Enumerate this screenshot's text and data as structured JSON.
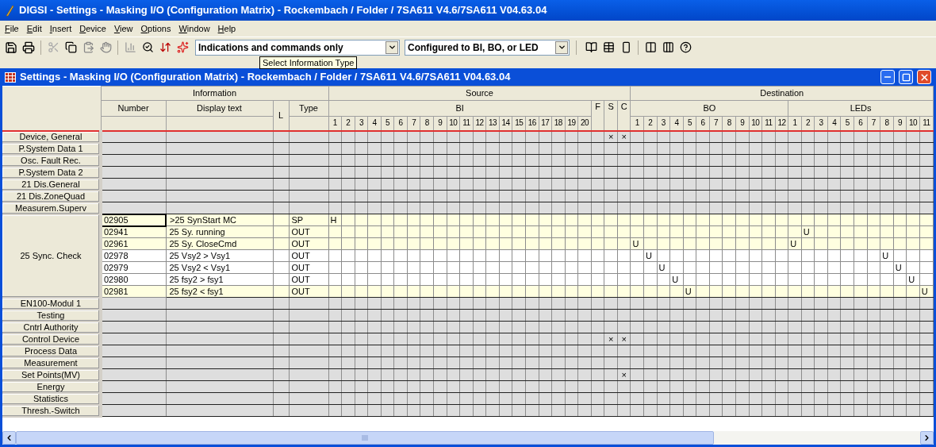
{
  "app_title": "DIGSI - Settings - Masking I/O (Configuration Matrix) - Rockembach / Folder / 7SA611 V4.6/7SA611 V04.63.04",
  "menu": [
    "File",
    "Edit",
    "Insert",
    "Device",
    "View",
    "Options",
    "Window",
    "Help"
  ],
  "toolbar": {
    "info_type": "Indications and commands only",
    "filter": "Configured to BI, BO, or LED",
    "tooltip": "Select Information Type"
  },
  "document_title": "Settings - Masking I/O (Configuration Matrix) - Rockembach / Folder / 7SA611 V4.6/7SA611 V04.63.04",
  "matrix": {
    "headers": {
      "information": "Information",
      "source": "Source",
      "destination": "Destination",
      "number": "Number",
      "display_text": "Display text",
      "l": "L",
      "type": "Type",
      "bi": "BI",
      "bo": "BO",
      "leds": "LEDs"
    },
    "bi_columns": [
      "1",
      "2",
      "3",
      "4",
      "5",
      "6",
      "7",
      "8",
      "9",
      "10",
      "11",
      "12",
      "13",
      "14",
      "15",
      "16",
      "17",
      "18",
      "19",
      "20"
    ],
    "fsc_columns": [
      "F",
      "S",
      "C"
    ],
    "bo_columns": [
      "1",
      "2",
      "3",
      "4",
      "5",
      "6",
      "7",
      "8",
      "9",
      "10",
      "11",
      "12"
    ],
    "led_columns": [
      "1",
      "2",
      "3",
      "4",
      "5",
      "6",
      "7",
      "8",
      "9",
      "10",
      "11"
    ],
    "groups": [
      {
        "name": "Device, General",
        "s_mark": "×",
        "c_mark": "×"
      },
      {
        "name": "P.System Data 1"
      },
      {
        "name": "Osc. Fault Rec."
      },
      {
        "name": "P.System Data 2"
      },
      {
        "name": "21 Dis.General"
      },
      {
        "name": "21 Dis.ZoneQuad"
      },
      {
        "name": "Measurem.Superv"
      },
      {
        "name": "25 Sync. Check",
        "rows": [
          {
            "number": "02905",
            "text": ">25 SynStart MC",
            "type": "SP",
            "shaded": true,
            "selected": true,
            "bi": [
              {
                "kind": "mark",
                "text": "H"
              },
              {
                "kind": "empty"
              },
              {
                "kind": "empty"
              },
              {
                "kind": "empty"
              },
              {
                "kind": "empty"
              },
              {
                "kind": "empty"
              },
              {
                "kind": "empty"
              },
              {
                "kind": "empty"
              },
              {
                "kind": "empty"
              },
              {
                "kind": "empty"
              },
              {
                "kind": "empty"
              },
              {
                "kind": "empty"
              },
              {
                "kind": "empty"
              },
              {
                "kind": "empty"
              },
              {
                "kind": "empty"
              },
              {
                "kind": "empty"
              },
              {
                "kind": "empty"
              },
              {
                "kind": "empty"
              },
              {
                "kind": "empty"
              },
              {
                "kind": "empty"
              }
            ],
            "bo": [
              {
                "kind": "empty"
              },
              {
                "kind": "empty"
              },
              {
                "kind": "empty"
              },
              {
                "kind": "empty"
              },
              {
                "kind": "empty"
              },
              {
                "kind": "empty"
              },
              {
                "kind": "empty"
              },
              {
                "kind": "empty"
              },
              {
                "kind": "empty"
              },
              {
                "kind": "empty"
              },
              {
                "kind": "empty"
              },
              {
                "kind": "empty"
              }
            ],
            "leds": [
              {
                "kind": "empty"
              },
              {
                "kind": "empty"
              },
              {
                "kind": "empty"
              },
              {
                "kind": "empty"
              },
              {
                "kind": "empty"
              },
              {
                "kind": "empty"
              },
              {
                "kind": "empty"
              },
              {
                "kind": "empty"
              },
              {
                "kind": "empty"
              },
              {
                "kind": "empty"
              },
              {
                "kind": "empty"
              }
            ]
          },
          {
            "number": "02941",
            "text": "25 Sy. running",
            "type": "OUT",
            "shaded": true,
            "selected": false,
            "bi": [
              {
                "kind": "empty"
              },
              {
                "kind": "empty"
              },
              {
                "kind": "empty"
              },
              {
                "kind": "empty"
              },
              {
                "kind": "empty"
              },
              {
                "kind": "empty"
              },
              {
                "kind": "empty"
              },
              {
                "kind": "empty"
              },
              {
                "kind": "empty"
              },
              {
                "kind": "empty"
              },
              {
                "kind": "empty"
              },
              {
                "kind": "empty"
              },
              {
                "kind": "empty"
              },
              {
                "kind": "empty"
              },
              {
                "kind": "empty"
              },
              {
                "kind": "empty"
              },
              {
                "kind": "empty"
              },
              {
                "kind": "empty"
              },
              {
                "kind": "empty"
              },
              {
                "kind": "empty"
              }
            ],
            "bo": [
              {
                "kind": "empty"
              },
              {
                "kind": "empty"
              },
              {
                "kind": "empty"
              },
              {
                "kind": "empty"
              },
              {
                "kind": "empty"
              },
              {
                "kind": "empty"
              },
              {
                "kind": "empty"
              },
              {
                "kind": "empty"
              },
              {
                "kind": "empty"
              },
              {
                "kind": "empty"
              },
              {
                "kind": "empty"
              },
              {
                "kind": "empty"
              }
            ],
            "leds": [
              {
                "kind": "empty"
              },
              {
                "kind": "mark",
                "text": "U"
              },
              {
                "kind": "empty"
              },
              {
                "kind": "empty"
              },
              {
                "kind": "empty"
              },
              {
                "kind": "empty"
              },
              {
                "kind": "empty"
              },
              {
                "kind": "empty"
              },
              {
                "kind": "empty"
              },
              {
                "kind": "empty"
              },
              {
                "kind": "empty"
              }
            ]
          },
          {
            "number": "02961",
            "text": "25 Sy. CloseCmd",
            "type": "OUT",
            "shaded": true,
            "selected": false,
            "bi": [
              {
                "kind": "empty"
              },
              {
                "kind": "empty"
              },
              {
                "kind": "empty"
              },
              {
                "kind": "empty"
              },
              {
                "kind": "empty"
              },
              {
                "kind": "empty"
              },
              {
                "kind": "empty"
              },
              {
                "kind": "empty"
              },
              {
                "kind": "empty"
              },
              {
                "kind": "empty"
              },
              {
                "kind": "empty"
              },
              {
                "kind": "empty"
              },
              {
                "kind": "empty"
              },
              {
                "kind": "empty"
              },
              {
                "kind": "empty"
              },
              {
                "kind": "empty"
              },
              {
                "kind": "empty"
              },
              {
                "kind": "empty"
              },
              {
                "kind": "empty"
              },
              {
                "kind": "empty"
              }
            ],
            "bo": [
              {
                "kind": "mark",
                "text": "U"
              },
              {
                "kind": "empty"
              },
              {
                "kind": "empty"
              },
              {
                "kind": "empty"
              },
              {
                "kind": "empty"
              },
              {
                "kind": "empty"
              },
              {
                "kind": "empty"
              },
              {
                "kind": "empty"
              },
              {
                "kind": "empty"
              },
              {
                "kind": "empty"
              },
              {
                "kind": "empty"
              },
              {
                "kind": "empty"
              }
            ],
            "leds": [
              {
                "kind": "mark",
                "text": "U"
              },
              {
                "kind": "empty"
              },
              {
                "kind": "empty"
              },
              {
                "kind": "empty"
              },
              {
                "kind": "empty"
              },
              {
                "kind": "empty"
              },
              {
                "kind": "empty"
              },
              {
                "kind": "empty"
              },
              {
                "kind": "empty"
              },
              {
                "kind": "empty"
              },
              {
                "kind": "empty"
              }
            ]
          },
          {
            "number": "02978",
            "text": "25 Vsy2 > Vsy1",
            "type": "OUT",
            "shaded": false,
            "selected": false,
            "bi": [
              {
                "kind": "empty"
              },
              {
                "kind": "empty"
              },
              {
                "kind": "empty"
              },
              {
                "kind": "empty"
              },
              {
                "kind": "empty"
              },
              {
                "kind": "empty"
              },
              {
                "kind": "empty"
              },
              {
                "kind": "empty"
              },
              {
                "kind": "empty"
              },
              {
                "kind": "empty"
              },
              {
                "kind": "empty"
              },
              {
                "kind": "empty"
              },
              {
                "kind": "empty"
              },
              {
                "kind": "empty"
              },
              {
                "kind": "empty"
              },
              {
                "kind": "empty"
              },
              {
                "kind": "empty"
              },
              {
                "kind": "empty"
              },
              {
                "kind": "empty"
              },
              {
                "kind": "empty"
              }
            ],
            "bo": [
              {
                "kind": "empty"
              },
              {
                "kind": "mark",
                "text": "U"
              },
              {
                "kind": "empty"
              },
              {
                "kind": "empty"
              },
              {
                "kind": "empty"
              },
              {
                "kind": "empty"
              },
              {
                "kind": "empty"
              },
              {
                "kind": "empty"
              },
              {
                "kind": "empty"
              },
              {
                "kind": "empty"
              },
              {
                "kind": "empty"
              },
              {
                "kind": "empty"
              }
            ],
            "leds": [
              {
                "kind": "empty"
              },
              {
                "kind": "empty"
              },
              {
                "kind": "empty"
              },
              {
                "kind": "empty"
              },
              {
                "kind": "empty"
              },
              {
                "kind": "empty"
              },
              {
                "kind": "empty"
              },
              {
                "kind": "mark",
                "text": "U"
              },
              {
                "kind": "empty"
              },
              {
                "kind": "empty"
              },
              {
                "kind": "empty"
              }
            ]
          },
          {
            "number": "02979",
            "text": "25 Vsy2 < Vsy1",
            "type": "OUT",
            "shaded": false,
            "selected": false,
            "bi": [
              {
                "kind": "empty"
              },
              {
                "kind": "empty"
              },
              {
                "kind": "empty"
              },
              {
                "kind": "empty"
              },
              {
                "kind": "empty"
              },
              {
                "kind": "empty"
              },
              {
                "kind": "empty"
              },
              {
                "kind": "empty"
              },
              {
                "kind": "empty"
              },
              {
                "kind": "empty"
              },
              {
                "kind": "empty"
              },
              {
                "kind": "empty"
              },
              {
                "kind": "empty"
              },
              {
                "kind": "empty"
              },
              {
                "kind": "empty"
              },
              {
                "kind": "empty"
              },
              {
                "kind": "empty"
              },
              {
                "kind": "empty"
              },
              {
                "kind": "empty"
              },
              {
                "kind": "empty"
              }
            ],
            "bo": [
              {
                "kind": "empty"
              },
              {
                "kind": "empty"
              },
              {
                "kind": "mark",
                "text": "U"
              },
              {
                "kind": "empty"
              },
              {
                "kind": "empty"
              },
              {
                "kind": "empty"
              },
              {
                "kind": "empty"
              },
              {
                "kind": "empty"
              },
              {
                "kind": "empty"
              },
              {
                "kind": "empty"
              },
              {
                "kind": "empty"
              },
              {
                "kind": "empty"
              }
            ],
            "leds": [
              {
                "kind": "empty"
              },
              {
                "kind": "empty"
              },
              {
                "kind": "empty"
              },
              {
                "kind": "empty"
              },
              {
                "kind": "empty"
              },
              {
                "kind": "empty"
              },
              {
                "kind": "empty"
              },
              {
                "kind": "empty"
              },
              {
                "kind": "mark",
                "text": "U"
              },
              {
                "kind": "empty"
              },
              {
                "kind": "empty"
              }
            ]
          },
          {
            "number": "02980",
            "text": "25 fsy2 > fsy1",
            "type": "OUT",
            "shaded": false,
            "selected": false,
            "bi": [
              {
                "kind": "empty"
              },
              {
                "kind": "empty"
              },
              {
                "kind": "empty"
              },
              {
                "kind": "empty"
              },
              {
                "kind": "empty"
              },
              {
                "kind": "empty"
              },
              {
                "kind": "empty"
              },
              {
                "kind": "empty"
              },
              {
                "kind": "empty"
              },
              {
                "kind": "empty"
              },
              {
                "kind": "empty"
              },
              {
                "kind": "empty"
              },
              {
                "kind": "empty"
              },
              {
                "kind": "empty"
              },
              {
                "kind": "empty"
              },
              {
                "kind": "empty"
              },
              {
                "kind": "empty"
              },
              {
                "kind": "empty"
              },
              {
                "kind": "empty"
              },
              {
                "kind": "empty"
              }
            ],
            "bo": [
              {
                "kind": "empty"
              },
              {
                "kind": "empty"
              },
              {
                "kind": "empty"
              },
              {
                "kind": "mark",
                "text": "U"
              },
              {
                "kind": "empty"
              },
              {
                "kind": "empty"
              },
              {
                "kind": "empty"
              },
              {
                "kind": "empty"
              },
              {
                "kind": "empty"
              },
              {
                "kind": "empty"
              },
              {
                "kind": "empty"
              },
              {
                "kind": "empty"
              }
            ],
            "leds": [
              {
                "kind": "empty"
              },
              {
                "kind": "empty"
              },
              {
                "kind": "empty"
              },
              {
                "kind": "empty"
              },
              {
                "kind": "empty"
              },
              {
                "kind": "empty"
              },
              {
                "kind": "empty"
              },
              {
                "kind": "empty"
              },
              {
                "kind": "empty"
              },
              {
                "kind": "mark",
                "text": "U"
              },
              {
                "kind": "empty"
              }
            ]
          },
          {
            "number": "02981",
            "text": "25 fsy2 < fsy1",
            "type": "OUT",
            "shaded": true,
            "selected": false,
            "bi": [
              {
                "kind": "empty"
              },
              {
                "kind": "empty"
              },
              {
                "kind": "empty"
              },
              {
                "kind": "empty"
              },
              {
                "kind": "empty"
              },
              {
                "kind": "empty"
              },
              {
                "kind": "empty"
              },
              {
                "kind": "empty"
              },
              {
                "kind": "empty"
              },
              {
                "kind": "empty"
              },
              {
                "kind": "empty"
              },
              {
                "kind": "empty"
              },
              {
                "kind": "empty"
              },
              {
                "kind": "empty"
              },
              {
                "kind": "empty"
              },
              {
                "kind": "empty"
              },
              {
                "kind": "empty"
              },
              {
                "kind": "empty"
              },
              {
                "kind": "empty"
              },
              {
                "kind": "empty"
              }
            ],
            "bo": [
              {
                "kind": "empty"
              },
              {
                "kind": "empty"
              },
              {
                "kind": "empty"
              },
              {
                "kind": "empty"
              },
              {
                "kind": "mark",
                "text": "U"
              },
              {
                "kind": "empty"
              },
              {
                "kind": "empty"
              },
              {
                "kind": "empty"
              },
              {
                "kind": "empty"
              },
              {
                "kind": "empty"
              },
              {
                "kind": "empty"
              },
              {
                "kind": "empty"
              }
            ],
            "leds": [
              {
                "kind": "empty"
              },
              {
                "kind": "empty"
              },
              {
                "kind": "empty"
              },
              {
                "kind": "empty"
              },
              {
                "kind": "empty"
              },
              {
                "kind": "empty"
              },
              {
                "kind": "empty"
              },
              {
                "kind": "empty"
              },
              {
                "kind": "empty"
              },
              {
                "kind": "empty"
              },
              {
                "kind": "mark",
                "text": "U"
              }
            ]
          }
        ]
      },
      {
        "name": "EN100-Modul 1"
      },
      {
        "name": "Testing"
      },
      {
        "name": "Cntrl Authority"
      },
      {
        "name": "Control Device",
        "s_mark": "×",
        "c_mark": "×"
      },
      {
        "name": "Process Data"
      },
      {
        "name": "Measurement"
      },
      {
        "name": "Set Points(MV)",
        "c_mark": "×"
      },
      {
        "name": "Energy"
      },
      {
        "name": "Statistics"
      },
      {
        "name": "Thresh.-Switch"
      }
    ]
  }
}
